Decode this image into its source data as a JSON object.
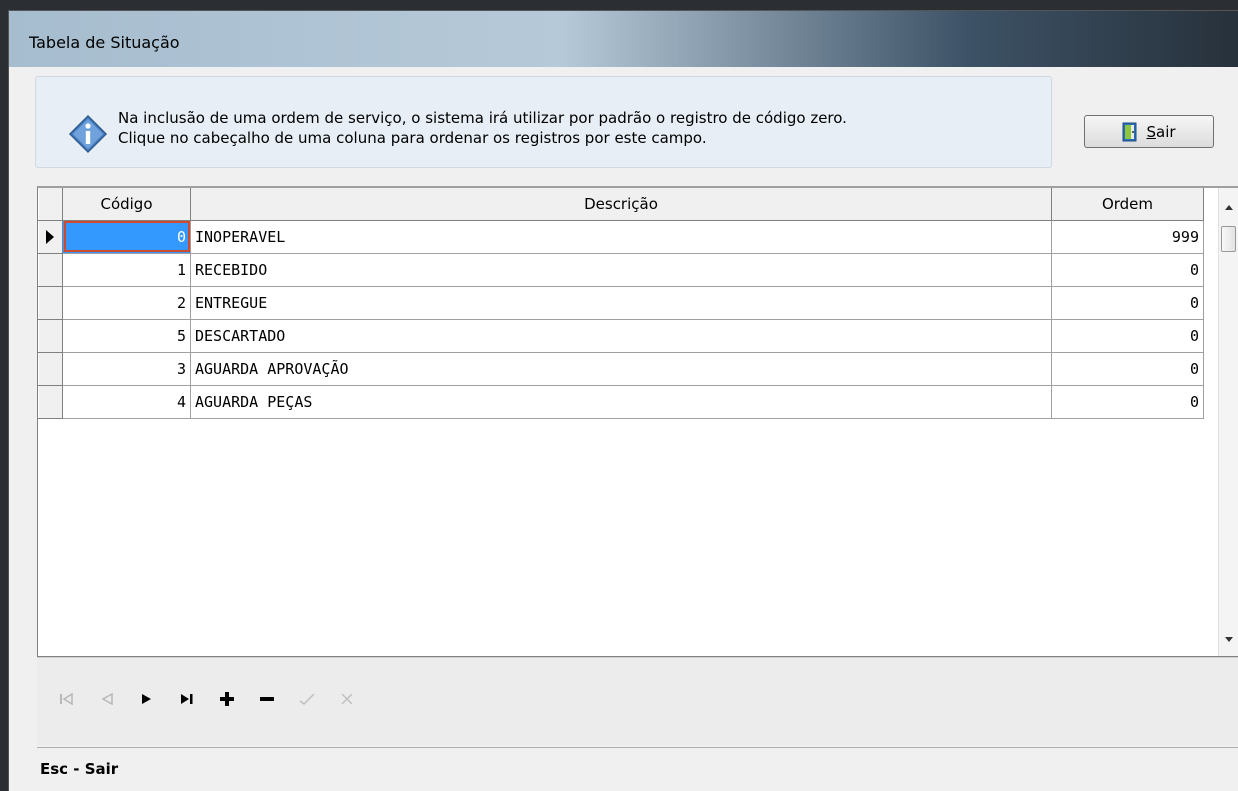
{
  "window": {
    "title": "Tabela de Situação"
  },
  "info": {
    "line1": "Na inclusão de uma ordem de serviço, o sistema irá utilizar por padrão o registro de código zero.",
    "line2": "Clique no cabeçalho de uma coluna para ordenar os registros por este campo.",
    "icon": "info-icon"
  },
  "sair_button": {
    "label": "Sair",
    "icon": "exit-door-icon"
  },
  "grid": {
    "columns": [
      "Código",
      "Descrição",
      "Ordem"
    ],
    "rows": [
      {
        "codigo": "0",
        "descricao": "INOPERAVEL",
        "ordem": "999"
      },
      {
        "codigo": "1",
        "descricao": "RECEBIDO",
        "ordem": "0"
      },
      {
        "codigo": "2",
        "descricao": "ENTREGUE",
        "ordem": "0"
      },
      {
        "codigo": "5",
        "descricao": "DESCARTADO",
        "ordem": "0"
      },
      {
        "codigo": "3",
        "descricao": "AGUARDA APROVAÇÃO",
        "ordem": "0"
      },
      {
        "codigo": "4",
        "descricao": "AGUARDA PEÇAS",
        "ordem": "0"
      }
    ],
    "selected_row": 0
  },
  "navigator": [
    "first-record-icon",
    "prior-record-icon",
    "next-record-icon",
    "last-record-icon",
    "insert-icon",
    "delete-icon",
    "post-icon",
    "cancel-icon"
  ],
  "status": {
    "text": "Esc - Sair"
  },
  "colors": {
    "selection": "#3399ff",
    "selection_border": "#cf4a2e"
  }
}
